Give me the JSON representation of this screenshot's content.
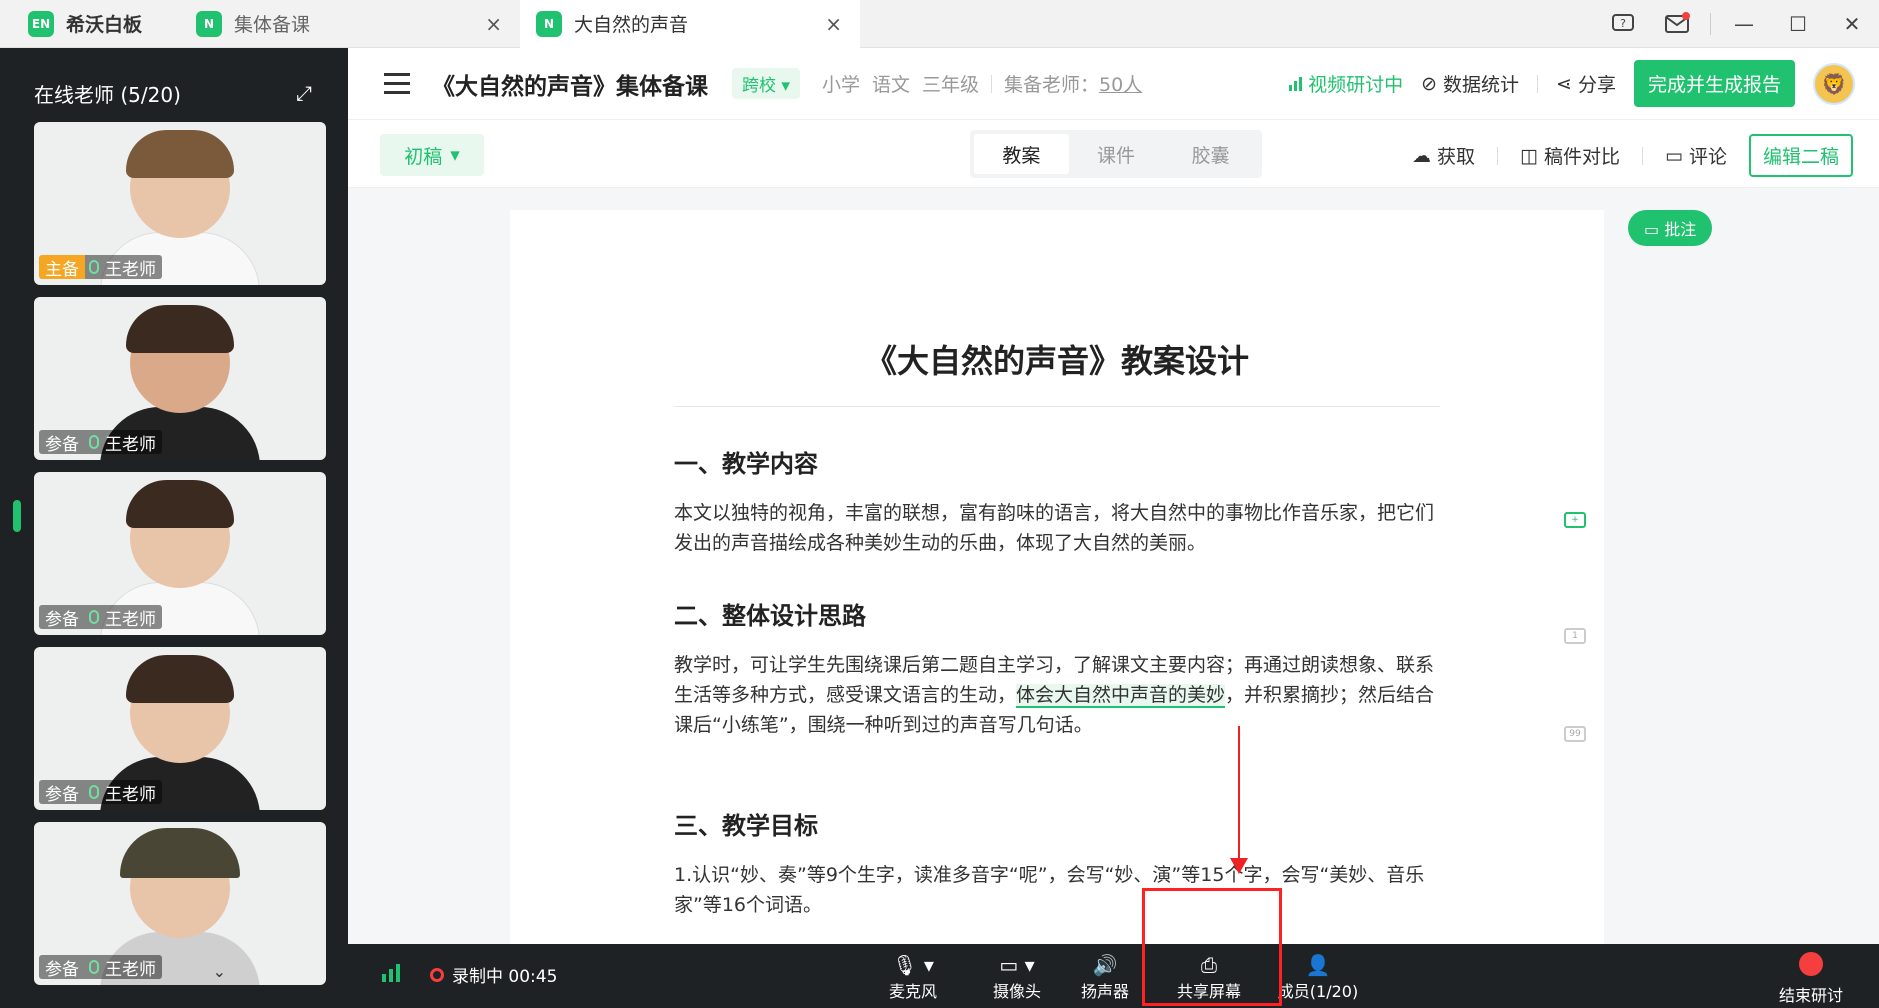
{
  "titlebar": {
    "brand": "希沃白板",
    "brand_logo": "EN",
    "tabs": [
      {
        "logo": "N",
        "label": "集体备课"
      },
      {
        "logo": "N",
        "label": "大自然的声音"
      }
    ]
  },
  "sidebar": {
    "title": "在线老师 (5/20)",
    "teachers": [
      {
        "role": "主备",
        "name": "王老师"
      },
      {
        "role": "参备",
        "name": "王老师"
      },
      {
        "role": "参备",
        "name": "王老师"
      },
      {
        "role": "参备",
        "name": "王老师"
      },
      {
        "role": "参备",
        "name": "王老师"
      }
    ]
  },
  "header": {
    "title": "《大自然的声音》集体备课",
    "badge": "跨校",
    "grade": [
      "小学",
      "语文",
      "三年级"
    ],
    "teachers_label": "集备老师：",
    "teachers_count": "50人",
    "video": "视频研讨中",
    "stats": "数据统计",
    "share": "分享",
    "finish": "完成并生成报告"
  },
  "toolbar": {
    "draft": "初稿",
    "tabs": [
      "教案",
      "课件",
      "胶囊"
    ],
    "active_tab": "教案",
    "get": "获取",
    "compare": "稿件对比",
    "comment": "评论",
    "edit": "编辑二稿"
  },
  "doc": {
    "annotate": "批注",
    "title": "《大自然的声音》教案设计",
    "s1_title": "一、教学内容",
    "s1_text": "本文以独特的视角，丰富的联想，富有韵味的语言，将大自然中的事物比作音乐家，把它们发出的声音描绘成各种美妙生动的乐曲，体现了大自然的美丽。",
    "s2_title": "二、整体设计思路",
    "s2_text_a": "教学时，可让学生先围绕课后第二题自主学习，了解课文主要内容；再通过朗读想象、联系生活等多种方式，感受课文语言的生动，",
    "s2_highlight": "体会大自然中声音的美妙",
    "s2_text_b": "，并积累摘抄；然后结合课后“小练笔”，围绕一种听到过的声音写几句话。",
    "s3_title": "三、教学目标",
    "s3_text": "1.认识“妙、奏”等9个生字，读准多音字“呢”，会写“妙、演”等15个字，会写“美妙、音乐家”等16个词语。",
    "side_badge2": "1",
    "side_badge3": "99"
  },
  "bottombar": {
    "rec": "录制中 00:45",
    "mic": "麦克风",
    "camera": "摄像头",
    "speaker": "扬声器",
    "share_screen": "共享屏幕",
    "members": "成员(1/20)",
    "end": "结束研讨"
  },
  "colors": {
    "accent": "#20c16f",
    "dark": "#1f2224",
    "danger": "#f53f3f"
  }
}
